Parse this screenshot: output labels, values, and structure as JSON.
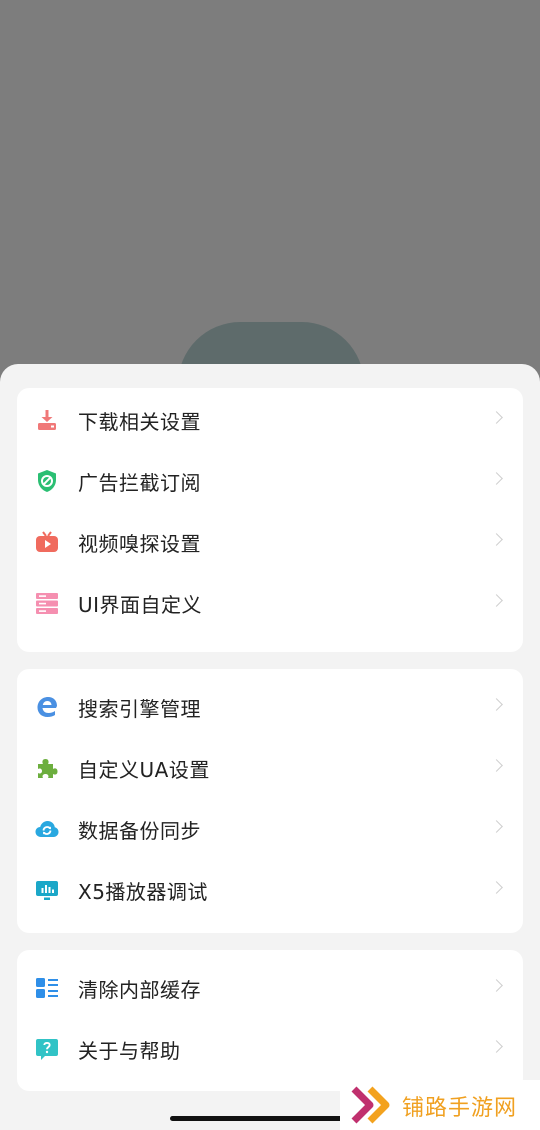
{
  "colors": {
    "overlay": "#7d7d7d",
    "sheet_bg": "#f3f3f3",
    "card_bg": "#ffffff",
    "text": "#222222",
    "chevron": "#cfcfcf",
    "watermark_text": "#f0a020"
  },
  "menu": {
    "groups": [
      {
        "items": [
          {
            "label": "下载相关设置",
            "icon": "download-icon"
          },
          {
            "label": "广告拦截订阅",
            "icon": "ad-block-shield-icon"
          },
          {
            "label": "视频嗅探设置",
            "icon": "tv-play-icon"
          },
          {
            "label": "UI界面自定义",
            "icon": "ui-layout-icon"
          }
        ]
      },
      {
        "items": [
          {
            "label": "搜索引擎管理",
            "icon": "edge-browser-icon"
          },
          {
            "label": "自定义UA设置",
            "icon": "puzzle-icon"
          },
          {
            "label": "数据备份同步",
            "icon": "cloud-sync-icon"
          },
          {
            "label": "X5播放器调试",
            "icon": "monitor-chart-icon"
          }
        ]
      },
      {
        "items": [
          {
            "label": "清除内部缓存",
            "icon": "grid-list-icon"
          },
          {
            "label": "关于与帮助",
            "icon": "help-question-icon"
          }
        ]
      }
    ]
  },
  "watermark": {
    "text": "铺路手游网",
    "logo": "double-chevron-logo"
  }
}
